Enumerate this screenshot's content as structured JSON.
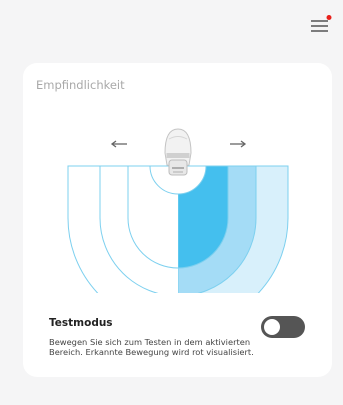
{
  "colors": {
    "background": "#f5f5f6",
    "card": "#ffffff",
    "arc_stroke": "#7dd0ef",
    "zone_outer": "#d8f0fb",
    "zone_middle": "#a4dcf6",
    "zone_inner": "#44bfee",
    "notification_dot": "#e8201b",
    "toggle_track": "#555555"
  },
  "header": {
    "menu_icon": "hamburger-menu-icon",
    "has_notification": true
  },
  "sensitivity": {
    "title": "Empfindlichkeit",
    "left_icon": "arrow-left-icon",
    "right_icon": "arrow-right-icon",
    "sensor_icon": "motion-sensor-icon",
    "active_side": "right",
    "level": 3,
    "max_level": 3
  },
  "test_mode": {
    "label": "Testmodus",
    "description": "Bewegen Sie sich zum Testen in dem aktivierten Bereich. Erkannte Bewegung wird rot visualisiert.",
    "enabled": false
  }
}
